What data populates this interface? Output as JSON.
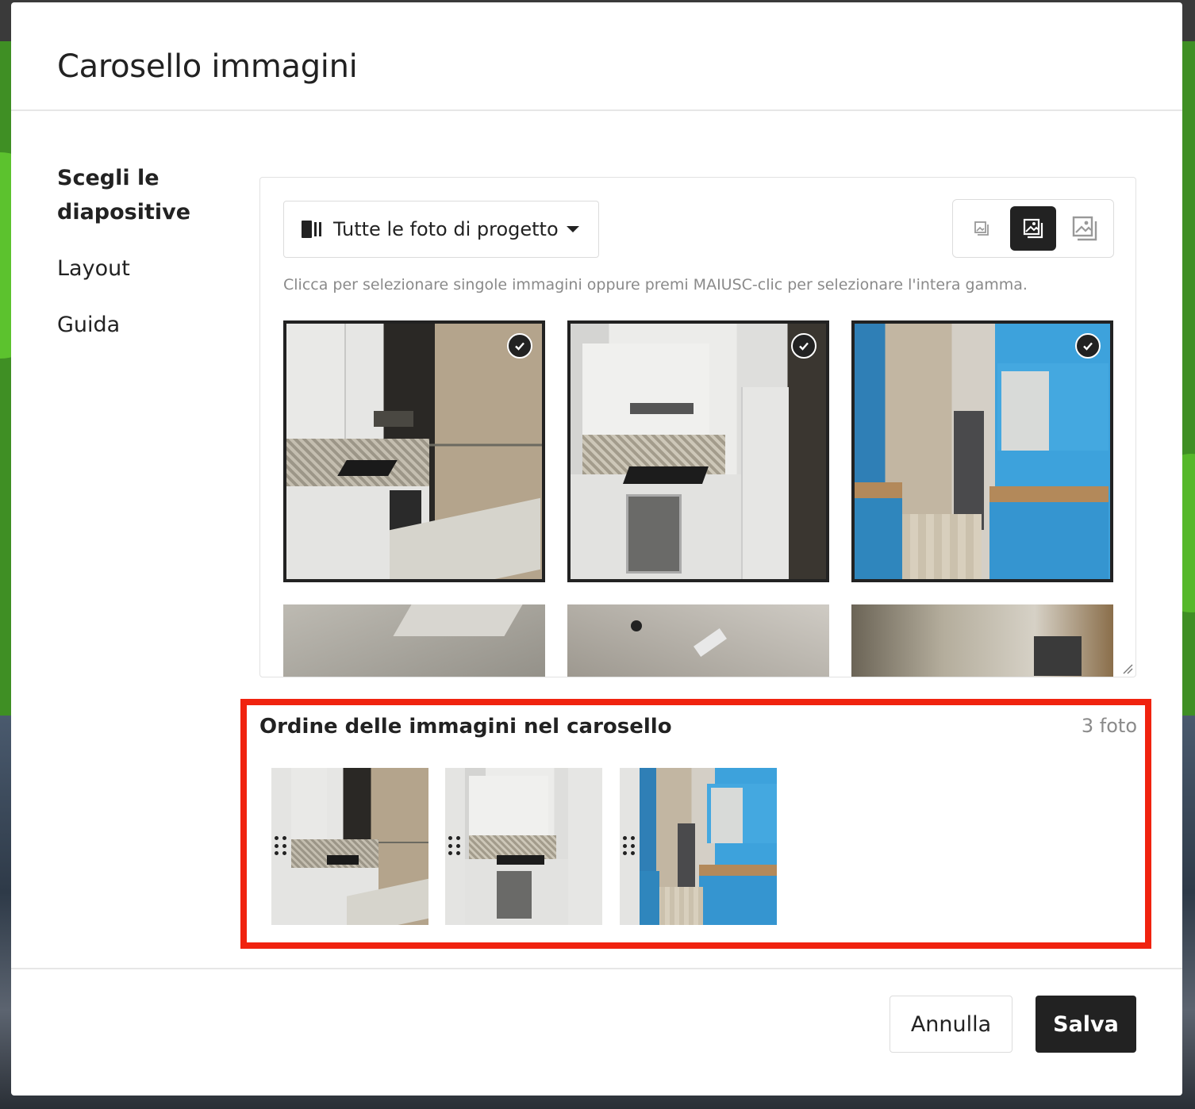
{
  "modal": {
    "title": "Carosello immagini"
  },
  "sidebar": {
    "items": [
      {
        "label": "Scegli le diapositive",
        "active": true
      },
      {
        "label": "Layout",
        "active": false
      },
      {
        "label": "Guida",
        "active": false
      }
    ]
  },
  "picker": {
    "source_dropdown": {
      "selected": "Tutte le foto di progetto",
      "icon": "photo-album-icon"
    },
    "size_toggle": {
      "options": [
        "small-image-icon",
        "medium-image-icon",
        "large-image-icon"
      ],
      "selected": "medium"
    },
    "hint": "Clicca per selezionare singole immagini oppure premi MAIUSC-clic per selezionare l'intera gamma.",
    "photos": [
      {
        "selected": true,
        "style": "kitchen-white-1"
      },
      {
        "selected": true,
        "style": "kitchen-white-2"
      },
      {
        "selected": true,
        "style": "kitchen-blue"
      },
      {
        "selected": false,
        "style": "ceiling-1"
      },
      {
        "selected": false,
        "style": "ceiling-2"
      },
      {
        "selected": false,
        "style": "construction"
      }
    ]
  },
  "order": {
    "title": "Ordine delle immagini nel carosello",
    "count": "3 foto",
    "items": [
      "kitchen-white-1",
      "kitchen-white-2",
      "kitchen-blue"
    ]
  },
  "footer": {
    "cancel_label": "Annulla",
    "save_label": "Salva"
  },
  "colors": {
    "accent_dark": "#222222",
    "highlight_border": "#f0230f",
    "hint_text": "#8a8a8a"
  }
}
